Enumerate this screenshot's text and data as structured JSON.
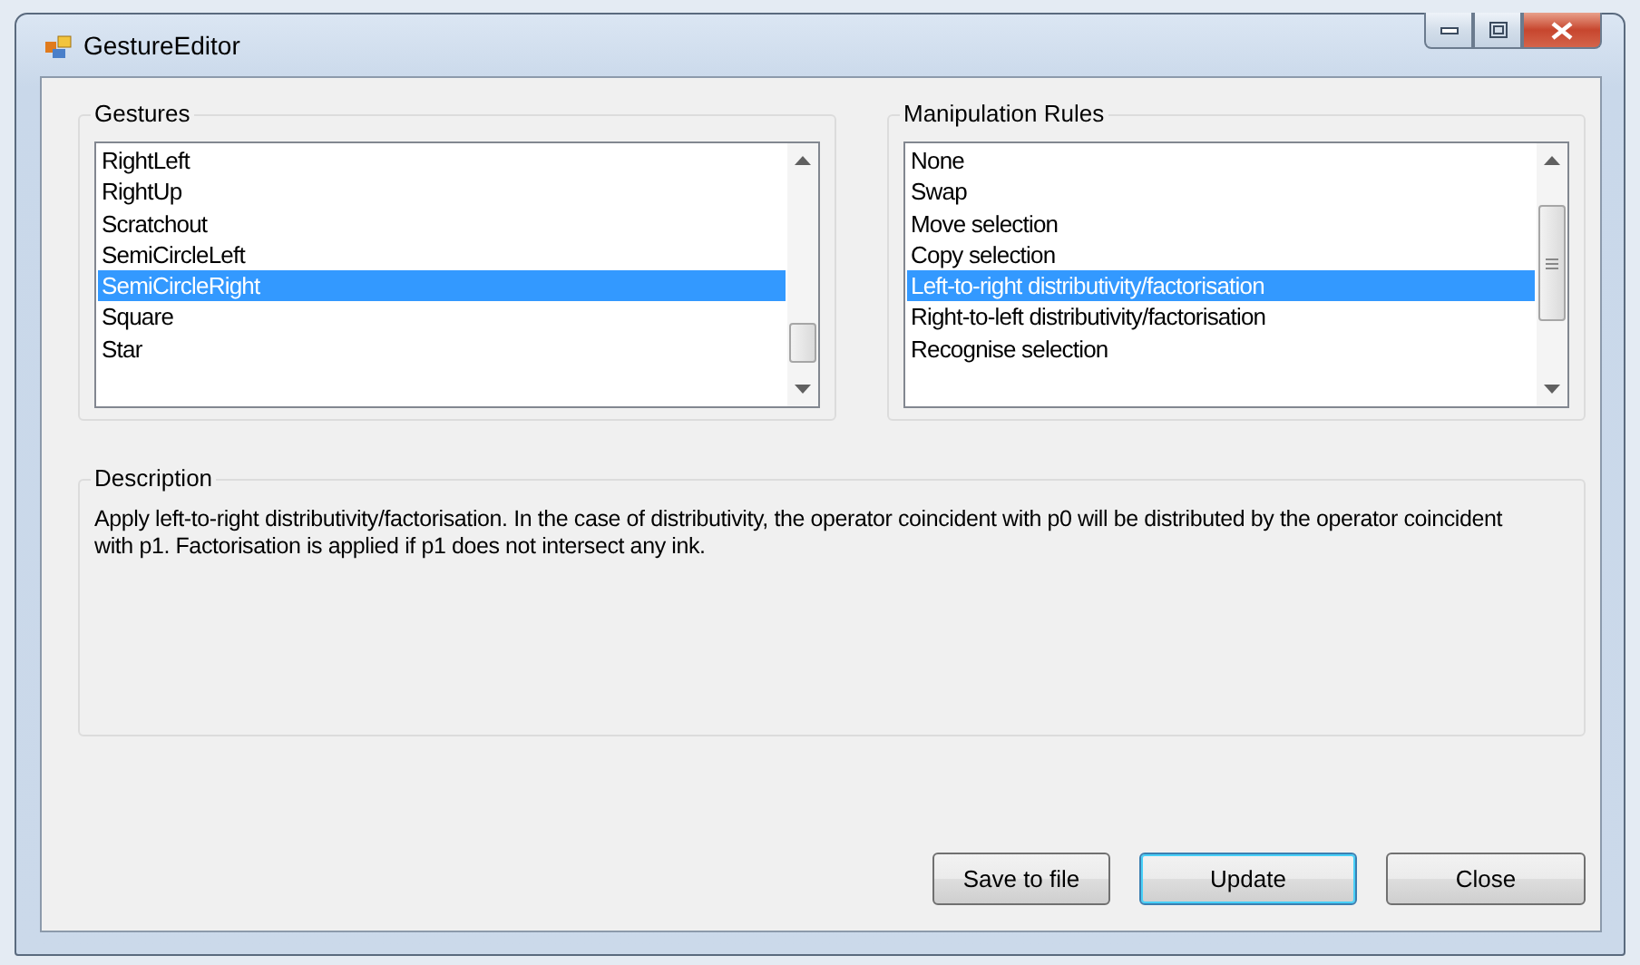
{
  "window": {
    "title": "GestureEditor"
  },
  "gestures": {
    "title": "Gestures",
    "items": [
      {
        "label": "RightLeft",
        "selected": false
      },
      {
        "label": "RightUp",
        "selected": false
      },
      {
        "label": "Scratchout",
        "selected": false
      },
      {
        "label": "SemiCircleLeft",
        "selected": false
      },
      {
        "label": "SemiCircleRight",
        "selected": true
      },
      {
        "label": "Square",
        "selected": false
      },
      {
        "label": "Star",
        "selected": false
      }
    ]
  },
  "rules": {
    "title": "Manipulation Rules",
    "items": [
      {
        "label": "None",
        "selected": false
      },
      {
        "label": "Swap",
        "selected": false
      },
      {
        "label": "Move selection",
        "selected": false
      },
      {
        "label": "Copy selection",
        "selected": false
      },
      {
        "label": "Left-to-right distributivity/factorisation",
        "selected": true
      },
      {
        "label": "Right-to-left distributivity/factorisation",
        "selected": false
      },
      {
        "label": "Recognise selection",
        "selected": false
      }
    ]
  },
  "description": {
    "title": "Description",
    "text": "Apply left-to-right distributivity/factorisation. In the case of distributivity, the operator coincident with p0 will be distributed by the operator coincident with p1. Factorisation is applied if p1 does not intersect any ink."
  },
  "buttons": [
    {
      "label": "Save to file",
      "default": false
    },
    {
      "label": "Update",
      "default": true
    },
    {
      "label": "Close",
      "default": false
    }
  ]
}
